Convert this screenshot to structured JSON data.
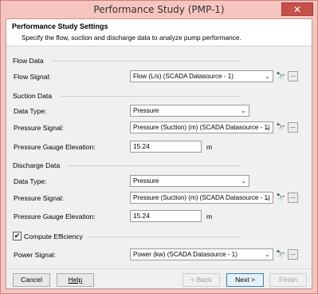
{
  "window": {
    "title": "Performance Study (PMP-1)",
    "close_glyph": "✕"
  },
  "header": {
    "title": "Performance Study Settings",
    "description": "Specify the flow, suction and discharge data to analyze pump performance."
  },
  "flow": {
    "group_title": "Flow Data",
    "signal_label": "Flow Signal:",
    "signal_value": "Flow (L/s) (SCADA Datasource - 1)"
  },
  "suction": {
    "group_title": "Suction Data",
    "data_type_label": "Data Type:",
    "data_type_value": "Pressure",
    "signal_label": "Pressure Signal:",
    "signal_value": "Pressure (Suction) (m) (SCADA Datasource - 1)",
    "elevation_label": "Pressure Gauge Elevation:",
    "elevation_value": "15.24",
    "elevation_unit": "m"
  },
  "discharge": {
    "group_title": "Discharge Data",
    "data_type_label": "Data Type:",
    "data_type_value": "Pressure",
    "signal_label": "Pressure Signal:",
    "signal_value": "Pressure (Suction) (m) (SCADA Datasource - 1)",
    "elevation_label": "Pressure Gauge Elevation:",
    "elevation_value": "15.24",
    "elevation_unit": "m"
  },
  "efficiency": {
    "checkbox_label": "Compute Efficiency",
    "checked": true,
    "signal_label": "Power Signal:",
    "signal_value": "Power (kw) (SCADA Datasource - 1)"
  },
  "icons": {
    "binoculars": "binoculars-icon",
    "ellipsis": "ellipsis-icon",
    "dropdown": "chevron-down-icon"
  },
  "glyphs": {
    "binoculars": "🔭",
    "ellipsis": "...",
    "dropdown": "⌄",
    "check": "✔"
  },
  "buttons": {
    "cancel": "Cancel",
    "help": "Help",
    "back": "< Back",
    "next": "Next >",
    "finish": "Finish"
  },
  "colors": {
    "title_bar": "#f7c5c0",
    "close_button": "#c7504a"
  }
}
